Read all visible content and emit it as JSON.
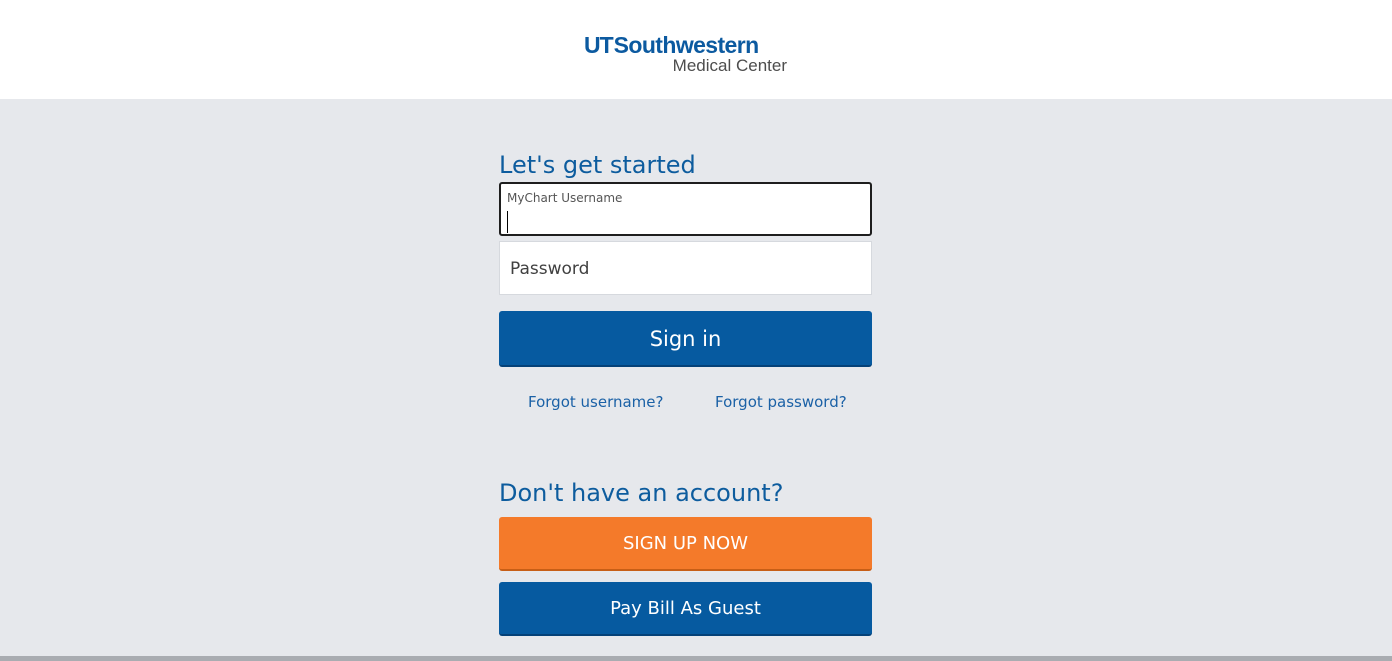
{
  "header": {
    "logo": {
      "brand_prefix": "UT",
      "brand_name": "Southwestern",
      "subtitle": "Medical Center"
    }
  },
  "login": {
    "heading": "Let's get started",
    "username": {
      "label": "MyChart Username",
      "value": ""
    },
    "password": {
      "placeholder": "Password"
    },
    "signin_label": "Sign in",
    "forgot_username": "Forgot username?",
    "forgot_password": "Forgot password?"
  },
  "signup": {
    "heading": "Don't have an account?",
    "signup_label": "SIGN UP NOW",
    "guest_label": "Pay Bill As Guest"
  },
  "colors": {
    "brand_blue": "#065aa0",
    "accent_orange": "#f47a2a",
    "background": "#e6e8ec"
  }
}
